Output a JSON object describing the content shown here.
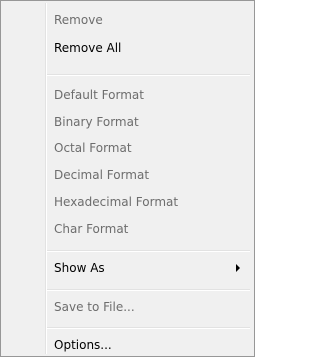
{
  "menu": {
    "items": [
      {
        "label": "Remove",
        "enabled": false
      },
      {
        "label": "Remove All",
        "enabled": true
      },
      {
        "label": "Default Format",
        "enabled": false
      },
      {
        "label": "Binary Format",
        "enabled": false
      },
      {
        "label": "Octal Format",
        "enabled": false
      },
      {
        "label": "Decimal Format",
        "enabled": false
      },
      {
        "label": "Hexadecimal Format",
        "enabled": false
      },
      {
        "label": "Char Format",
        "enabled": false
      },
      {
        "label": "Show As",
        "enabled": true,
        "submenu": true
      },
      {
        "label": "Save to File...",
        "enabled": false
      },
      {
        "label": "Options...",
        "enabled": true
      }
    ]
  },
  "icons": {
    "submenu_arrow": "chevron-right-icon"
  }
}
